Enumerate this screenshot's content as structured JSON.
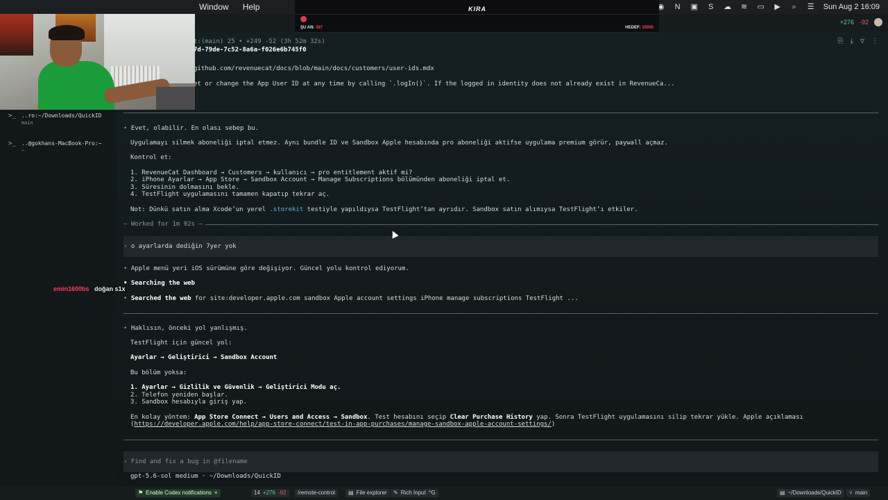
{
  "menubar": {
    "items": [
      "Window",
      "Help"
    ],
    "clock": "Sun Aug 2  16:09"
  },
  "overlay": {
    "brand": "KIRA",
    "current_label": "ŞU AN:",
    "current_value": "387",
    "target_label": "HEDEF:",
    "target_value": "10000"
  },
  "header": {
    "diff_add": "+276",
    "diff_del": "-92"
  },
  "sidebar": {
    "items": [
      {
        "title": "..ro:~/Downloads/QuickID",
        "sub": "main"
      },
      {
        "title": "..@gokhans-MacBook-Pro:~",
        "sub": "~"
      }
    ]
  },
  "chat": {
    "user": "emin1600bs",
    "message": "doğan s1x"
  },
  "transcript": {
    "session_line": "t:(main) 25 • +249 -52 (3h 52m 32s)",
    "session_id": "7d-79de-7c52-8a6a-f026e6b745f0",
    "doc_url": "github.com/revenuecat/docs/blob/main/docs/customers/user-ids.mdx",
    "doc_excerpt": "et or change the App User ID at any time by calling `.logIn()`. If the logged in identity does not already exist in RevenueCa...",
    "answer1_lead": "Evet, olabilir. En olası sebep bu.",
    "answer1_p1": "Uygulamayı silmek aboneliği iptal etmez. Aynı bundle ID ve Sandbox Apple hesabında pro aboneliği aktifse uygulama premium görür, paywall açmaz.",
    "answer1_check": "Kontrol et:",
    "answer1_steps": [
      "1. RevenueCat Dashboard → Customers → kullanıcı → pro entitlement aktif mi?",
      "2. iPhone Ayarlar → App Store → Sandbox Account → Manage Subscriptions bölümünden aboneliği iptal et.",
      "3. Süresinin dolmasını bekle.",
      "4. TestFlight uygulamasını tamamen kapatıp tekrar aç."
    ],
    "answer1_note_pre": "Not: Dünkü satın alma Xcode’un yerel ",
    "answer1_note_code": ".storekit",
    "answer1_note_post": " testiyle yapıldıysa TestFlight’tan ayrıdır. Sandbox satın alımıysa TestFlight’ı etkiler.",
    "worked": "— Worked for 1m 02s —",
    "user_msg": "o ayarlarda dediğin 7yer yok",
    "answer2_lead": "Apple menü yeri iOS sürümüne göre değişiyor. Güncel yolu kontrol ediyorum.",
    "searching": "Searching the web",
    "searched_label": "Searched the web",
    "searched_query": " for site:developer.apple.com sandbox Apple account settings iPhone manage subscriptions TestFlight ...",
    "answer3_lead": "Haklısın, önceki yol yanlışmış.",
    "answer3_path_intro": "TestFlight için güncel yol:",
    "answer3_path": "Ayarlar → Geliştirici → Sandbox Account",
    "answer3_else": "Bu bölüm yoksa:",
    "answer3_steps": [
      "1. Ayarlar → Gizlilik ve Güvenlik → Geliştirici Modu aç.",
      "2. Telefon yeniden başlar.",
      "3. Sandbox hesabıyla giriş yap."
    ],
    "easiest_pre": "En kolay yöntem: ",
    "easiest_bold": "App Store Connect → Users and Access → Sandbox",
    "easiest_mid": ". Test hesabını seçip ",
    "easiest_bold2": "Clear Purchase History",
    "easiest_post": " yap. Sonra TestFlight uygulamasını silip tekrar yükle. Apple açıklaması",
    "apple_link": "https://developer.apple.com/help/app-store-connect/test-in-app-purchases/manage-sandbox-apple-account-settings/"
  },
  "composer": {
    "placeholder": "Find and fix a bug in @filename",
    "model_line": "gpt-5.6-sol medium · ~/Downloads/QuickID"
  },
  "statusbar": {
    "notifications": "Enable Codex notifications",
    "count": "14",
    "add": "+276",
    "del": "-92",
    "remote": "/remote-control",
    "explorer": "File explorer",
    "rich": "Rich Input",
    "rich_key": "^G",
    "path": "~/Downloads/QuickID",
    "branch": "main"
  }
}
